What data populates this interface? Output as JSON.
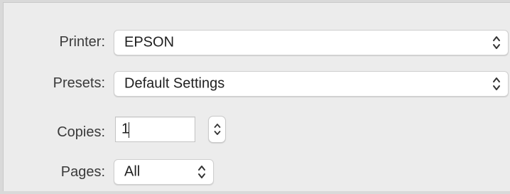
{
  "printer": {
    "label": "Printer:",
    "value": "EPSON"
  },
  "presets": {
    "label": "Presets:",
    "value": "Default Settings"
  },
  "copies": {
    "label": "Copies:",
    "value": "1"
  },
  "pages": {
    "label": "Pages:",
    "value": "All"
  },
  "icons": {
    "popup": "up-down-chevrons-icon",
    "stepper": "stepper-chevrons-icon"
  }
}
